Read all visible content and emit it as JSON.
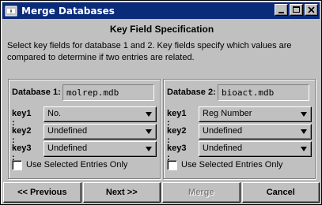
{
  "window": {
    "title": "Merge Databases",
    "icons": [
      "merge-databases-app-icon",
      "minimize-icon",
      "maximize-icon",
      "close-icon"
    ]
  },
  "heading": "Key Field Specification",
  "description": "Select key fields for database 1 and 2. Key fields specify which values are compared to determine if two entries are related.",
  "panels": [
    {
      "db_label": "Database 1:",
      "db_value": "molrep.mdb",
      "keys": [
        {
          "label": "key1 :",
          "value": "No."
        },
        {
          "label": "key2 :",
          "value": "Undefined"
        },
        {
          "label": "key3 :",
          "value": "Undefined"
        }
      ],
      "checkbox_label": "Use Selected Entries Only",
      "checkbox_checked": false
    },
    {
      "db_label": "Database 2:",
      "db_value": "bioact.mdb",
      "keys": [
        {
          "label": "key1 :",
          "value": "Reg Number"
        },
        {
          "label": "key2 :",
          "value": "Undefined"
        },
        {
          "label": "key3 :",
          "value": "Undefined"
        }
      ],
      "checkbox_label": "Use Selected Entries Only",
      "checkbox_checked": false
    }
  ],
  "buttons": {
    "previous": "<< Previous",
    "next": "Next >>",
    "merge": "Merge",
    "cancel": "Cancel",
    "merge_enabled": false
  },
  "colors": {
    "titlebar": "#0a2a7a",
    "face": "#c0c0c0",
    "disabled_text": "#808080"
  }
}
